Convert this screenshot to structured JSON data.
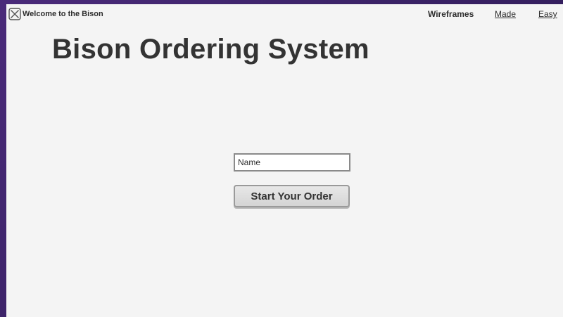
{
  "header": {
    "logo_icon": "placeholder-x-icon",
    "brand_text": "Welcome to the Bison",
    "nav_links": [
      "Wireframes",
      "Made",
      "Easy"
    ]
  },
  "main": {
    "title": "Bison Ordering System",
    "name_input": {
      "value": "",
      "placeholder": "Name"
    },
    "start_button_label": "Start Your Order"
  },
  "colors": {
    "page_background": "#f4f4f4",
    "outer_background": "#3a2266",
    "text": "#333333"
  }
}
